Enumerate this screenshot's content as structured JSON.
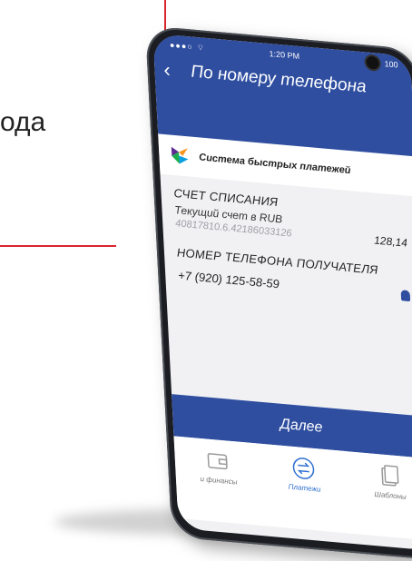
{
  "slide": {
    "partial_text": "ода"
  },
  "colors": {
    "accent_red": "#d9262e",
    "brand_blue": "#2f4ea0",
    "active_tab": "#2f6fd0"
  },
  "status_bar": {
    "time": "1:20 PM",
    "battery": "100"
  },
  "header": {
    "back_icon": "chevron-left-icon",
    "title": "По номеру телефона"
  },
  "sbp": {
    "logo_icon": "sbp-logo-icon",
    "label": "Система быстрых платежей"
  },
  "debit_account": {
    "section_label": "СЧЕТ СПИСАНИЯ",
    "account_name": "Текущий счет в RUB",
    "account_number": "40817810.6.42186033126",
    "balance": "128,14"
  },
  "recipient": {
    "section_label": "НОМЕР ТЕЛЕФОНА ПОЛУЧАТЕЛЯ",
    "phone": "+7 (920) 125-58-59",
    "contact_icon": "contact-icon"
  },
  "next_button": {
    "label": "Далее"
  },
  "tabbar": {
    "items": [
      {
        "label": "и финансы",
        "icon": "wallet-icon",
        "active": false
      },
      {
        "label": "Платежи",
        "icon": "payments-icon",
        "active": true
      },
      {
        "label": "Шаблоны",
        "icon": "templates-icon",
        "active": false
      }
    ]
  }
}
